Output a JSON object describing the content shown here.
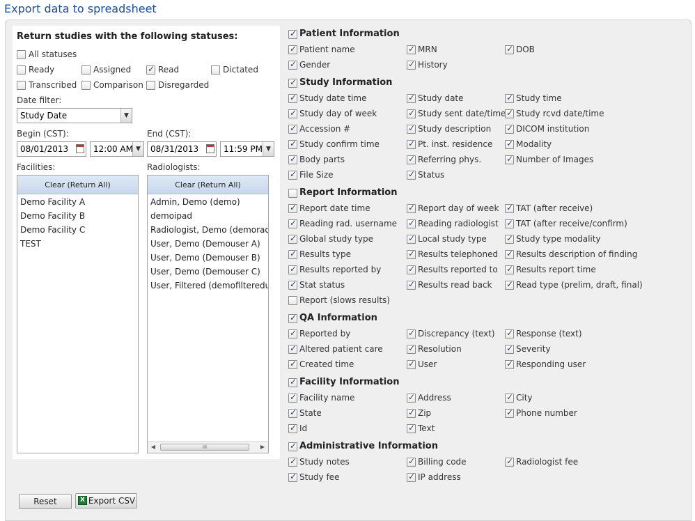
{
  "page_title": "Export data to spreadsheet",
  "statuses": {
    "heading": "Return studies with the following statuses:",
    "all": {
      "label": "All statuses",
      "checked": false
    },
    "items": [
      {
        "label": "Ready",
        "checked": false
      },
      {
        "label": "Assigned",
        "checked": false
      },
      {
        "label": "Read",
        "checked": true
      },
      {
        "label": "Dictated",
        "checked": false
      },
      {
        "label": "Transcribed",
        "checked": false
      },
      {
        "label": "Comparison",
        "checked": false
      },
      {
        "label": "Disregarded",
        "checked": false
      }
    ]
  },
  "date_filter": {
    "label": "Date filter:",
    "value": "Study Date"
  },
  "begin": {
    "label": "Begin (CST):",
    "date": "08/01/2013",
    "time": "12:00 AM"
  },
  "end": {
    "label": "End (CST):",
    "date": "08/31/2013",
    "time": "11:59 PM"
  },
  "facilities": {
    "label": "Facilities:",
    "clear_label": "Clear (Return All)",
    "items": [
      "Demo Facility A",
      "Demo Facility B",
      "Demo Facility C",
      "TEST"
    ]
  },
  "radiologists": {
    "label": "Radiologists:",
    "clear_label": "Clear (Return All)",
    "items": [
      "Admin, Demo (demo)",
      "demoipad",
      "Radiologist, Demo (demorad)",
      "User, Demo (Demouser A)",
      "User, Demo (Demouser B)",
      "User, Demo (Demouser C)",
      "User, Filtered (demofiltereduse"
    ]
  },
  "buttons": {
    "reset": "Reset",
    "export": "Export CSV"
  },
  "sections": [
    {
      "title": "Patient Information",
      "checked": true,
      "fields": [
        {
          "label": "Patient name",
          "checked": true
        },
        {
          "label": "MRN",
          "checked": true
        },
        {
          "label": "DOB",
          "checked": true
        },
        {
          "label": "Gender",
          "checked": true
        },
        {
          "label": "History",
          "checked": true
        }
      ]
    },
    {
      "title": "Study Information",
      "checked": true,
      "fields": [
        {
          "label": "Study date time",
          "checked": true
        },
        {
          "label": "Study date",
          "checked": true
        },
        {
          "label": "Study time",
          "checked": true
        },
        {
          "label": "Study day of week",
          "checked": true
        },
        {
          "label": "Study sent date/time",
          "checked": true
        },
        {
          "label": "Study rcvd date/time",
          "checked": true
        },
        {
          "label": "Accession #",
          "checked": true
        },
        {
          "label": "Study description",
          "checked": true
        },
        {
          "label": "DICOM institution",
          "checked": true
        },
        {
          "label": "Study confirm time",
          "checked": true
        },
        {
          "label": "Pt. inst. residence",
          "checked": true
        },
        {
          "label": "Modality",
          "checked": true
        },
        {
          "label": "Body parts",
          "checked": true
        },
        {
          "label": "Referring phys.",
          "checked": true
        },
        {
          "label": "Number of Images",
          "checked": true
        },
        {
          "label": "File Size",
          "checked": true
        },
        {
          "label": "Status",
          "checked": true
        }
      ]
    },
    {
      "title": "Report Information",
      "checked": false,
      "fields": [
        {
          "label": "Report date time",
          "checked": true
        },
        {
          "label": "Report day of week",
          "checked": true
        },
        {
          "label": "TAT (after receive)",
          "checked": true
        },
        {
          "label": "Reading rad. username",
          "checked": true
        },
        {
          "label": "Reading radiologist",
          "checked": true
        },
        {
          "label": "TAT (after receive/confirm)",
          "checked": true
        },
        {
          "label": "Global study type",
          "checked": true
        },
        {
          "label": "Local study type",
          "checked": true
        },
        {
          "label": "Study type modality",
          "checked": true
        },
        {
          "label": "Results type",
          "checked": true
        },
        {
          "label": "Results telephoned",
          "checked": true
        },
        {
          "label": "Results description of finding",
          "checked": true
        },
        {
          "label": "Results reported by",
          "checked": true
        },
        {
          "label": "Results reported to",
          "checked": true
        },
        {
          "label": "Results report time",
          "checked": true
        },
        {
          "label": "Stat status",
          "checked": true
        },
        {
          "label": "Results read back",
          "checked": true
        },
        {
          "label": "Read type (prelim, draft, final)",
          "checked": true
        },
        {
          "label": "Report (slows results)",
          "checked": false
        }
      ]
    },
    {
      "title": "QA Information",
      "checked": true,
      "fields": [
        {
          "label": "Reported by",
          "checked": true
        },
        {
          "label": "Discrepancy (text)",
          "checked": true
        },
        {
          "label": "Response (text)",
          "checked": true
        },
        {
          "label": "Altered patient care",
          "checked": true
        },
        {
          "label": "Resolution",
          "checked": true
        },
        {
          "label": "Severity",
          "checked": true
        },
        {
          "label": "Created time",
          "checked": true
        },
        {
          "label": "User",
          "checked": true
        },
        {
          "label": "Responding user",
          "checked": true
        }
      ]
    },
    {
      "title": "Facility Information",
      "checked": true,
      "fields": [
        {
          "label": "Facility name",
          "checked": true
        },
        {
          "label": "Address",
          "checked": true
        },
        {
          "label": "City",
          "checked": true
        },
        {
          "label": "State",
          "checked": true
        },
        {
          "label": "Zip",
          "checked": true
        },
        {
          "label": "Phone number",
          "checked": true
        },
        {
          "label": "Id",
          "checked": true
        },
        {
          "label": "Text",
          "checked": true
        }
      ]
    },
    {
      "title": "Administrative Information",
      "checked": true,
      "fields": [
        {
          "label": "Study notes",
          "checked": true
        },
        {
          "label": "Billing code",
          "checked": true
        },
        {
          "label": "Radiologist fee",
          "checked": true
        },
        {
          "label": "Study fee",
          "checked": true
        },
        {
          "label": "IP address",
          "checked": true
        }
      ]
    }
  ]
}
